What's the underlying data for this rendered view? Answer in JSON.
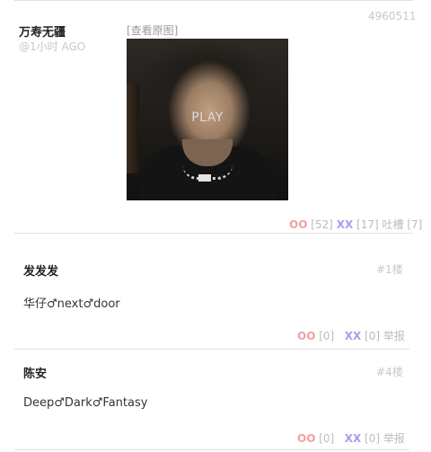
{
  "post": {
    "author": "万寿无疆",
    "time": "@1小时 AGO",
    "id": "4960511",
    "view_original": "[查看原图]",
    "play_label": "PLAY",
    "oo_label": "OO",
    "oo_count": "[52]",
    "xx_label": "XX",
    "xx_count": "[17]",
    "tucao_label": "吐槽",
    "tucao_count": "[7]"
  },
  "comments": [
    {
      "author": "发发发",
      "floor": "#1楼",
      "text": "华仔♂next♂door",
      "oo_label": "OO",
      "oo_count": "[0]",
      "xx_label": "XX",
      "xx_count": "[0]",
      "report": "举报"
    },
    {
      "author": "陈安",
      "floor": "#4楼",
      "text": "Deep♂Dark♂Fantasy",
      "oo_label": "OO",
      "oo_count": "[0]",
      "xx_label": "XX",
      "xx_count": "[0]",
      "report": "举报"
    }
  ]
}
